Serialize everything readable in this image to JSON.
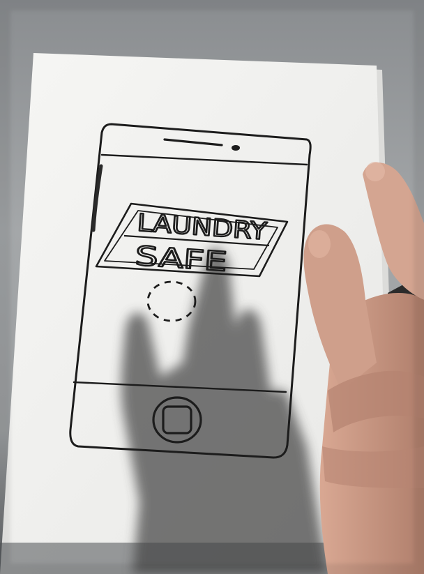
{
  "app": {
    "title_line1": "LAUNDRY",
    "title_line2": "SAFE"
  },
  "icons": {
    "loading_indicator": "dashed-circle-icon",
    "home_button": "home-button-icon",
    "camera": "camera-dot-icon"
  },
  "colors": {
    "paper": "#f2f2f0",
    "ink": "#1c1c1c",
    "skin": "#c99a86",
    "shadow": "#3f3f3f"
  }
}
